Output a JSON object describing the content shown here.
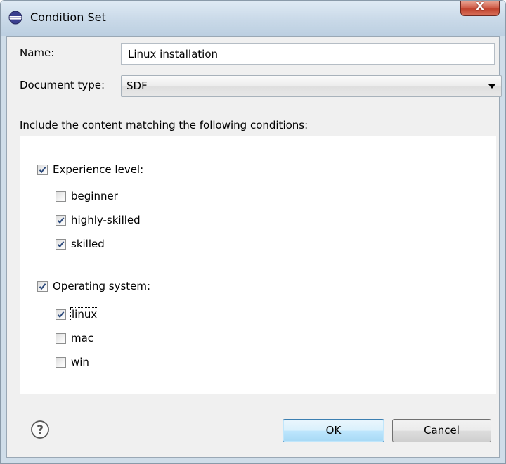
{
  "window": {
    "title": "Condition Set",
    "close_label": "X"
  },
  "form": {
    "name_label": "Name:",
    "name_value": "Linux installation",
    "doc_type_label": "Document type:",
    "doc_type_value": "SDF"
  },
  "conditions": {
    "intro": "Include the content matching the following conditions:",
    "groups": [
      {
        "label": "Experience level:",
        "checked": true,
        "items": [
          {
            "label": "beginner",
            "checked": false
          },
          {
            "label": "highly-skilled",
            "checked": true
          },
          {
            "label": "skilled",
            "checked": true
          }
        ]
      },
      {
        "label": "Operating system:",
        "checked": true,
        "items": [
          {
            "label": "linux",
            "checked": true
          },
          {
            "label": "mac",
            "checked": false
          },
          {
            "label": "win",
            "checked": false
          }
        ]
      }
    ]
  },
  "buttons": {
    "ok": "OK",
    "cancel": "Cancel"
  },
  "icons": {
    "app": "eclipse-icon",
    "help": "help-icon",
    "close": "close-icon"
  },
  "colors": {
    "titlebar": "#c9d9e8",
    "close_button": "#c0432e",
    "default_button": "#bee6fd",
    "check": "#2c4a7c"
  }
}
